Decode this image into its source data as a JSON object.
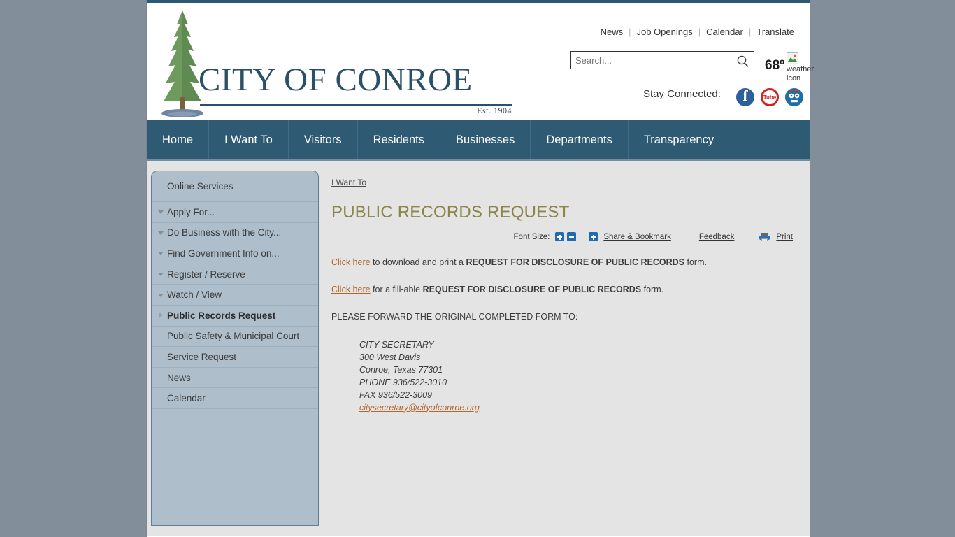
{
  "site": {
    "logo_text_city": "C",
    "logo_text": "ITY OF ",
    "logo_name": "ONROE",
    "logo_full": "CITY OF CONROE",
    "established": "Est. 1904"
  },
  "toplinks": [
    {
      "label": "News"
    },
    {
      "label": "Job Openings"
    },
    {
      "label": "Calendar"
    },
    {
      "label": "Translate"
    }
  ],
  "search": {
    "placeholder": "Search...",
    "value": ""
  },
  "weather": {
    "temperature": "68º",
    "broken_image_alt": "weather icon"
  },
  "social": {
    "label": "Stay Connected:",
    "items": [
      {
        "name": "facebook",
        "glyph": "f"
      },
      {
        "name": "youtube",
        "glyph": "Tube"
      },
      {
        "name": "periscope",
        "glyph": ""
      }
    ]
  },
  "nav": [
    {
      "label": "Home"
    },
    {
      "label": "I Want To"
    },
    {
      "label": "Visitors"
    },
    {
      "label": "Residents"
    },
    {
      "label": "Businesses"
    },
    {
      "label": "Departments"
    },
    {
      "label": "Transparency"
    }
  ],
  "sidebar": [
    {
      "label": "Online Services",
      "caret": "none",
      "active": false
    },
    {
      "label": "Apply For...",
      "caret": "down",
      "active": false
    },
    {
      "label": "Do Business with the City...",
      "caret": "down",
      "active": false
    },
    {
      "label": "Find Government Info on...",
      "caret": "down",
      "active": false
    },
    {
      "label": "Register / Reserve",
      "caret": "down",
      "active": false
    },
    {
      "label": "Watch / View",
      "caret": "down",
      "active": false
    },
    {
      "label": "Public Records Request",
      "caret": "right",
      "active": true
    },
    {
      "label": "Public Safety & Municipal Court",
      "caret": "none",
      "active": false
    },
    {
      "label": "Service Request",
      "caret": "none",
      "active": false
    },
    {
      "label": "News",
      "caret": "none",
      "active": false
    },
    {
      "label": "Calendar",
      "caret": "none",
      "active": false
    }
  ],
  "main": {
    "breadcrumb": "I Want To",
    "title": "PUBLIC RECORDS REQUEST",
    "toolbar": {
      "font_size_label": "Font Size:",
      "increase_label": "+",
      "decrease_label": "-",
      "share_label": "Share & Bookmark",
      "feedback_label": "Feedback",
      "print_label": "Print"
    },
    "paragraph1": {
      "link": "Click here",
      "mid": " to download and print a ",
      "bold": "REQUEST FOR DISCLOSURE OF PUBLIC RECORDS",
      "end": " form."
    },
    "paragraph2": {
      "link": "Click here",
      "mid": " for a fill-able ",
      "bold": "REQUEST FOR DISCLOSURE OF PUBLIC RECORDS",
      "end": " form."
    },
    "paragraph3": "PLEASE FORWARD THE ORIGINAL COMPLETED FORM TO:",
    "address": {
      "line1": "CITY SECRETARY",
      "line2": "300 West Davis",
      "line3": "Conroe, Texas 77301",
      "line4": "PHONE 936/522-3010",
      "line5": "FAX 936/522-3009",
      "email": "citysecretary@cityofconroe.org"
    }
  },
  "colors": {
    "page_bg": "#828f9a",
    "nav_bg": "#2e5b73",
    "sidebar_bg": "#aebecb",
    "content_bg": "#e4e4e4",
    "title": "#8b8547",
    "link": "#b4652a",
    "logo": "#2b5069"
  }
}
